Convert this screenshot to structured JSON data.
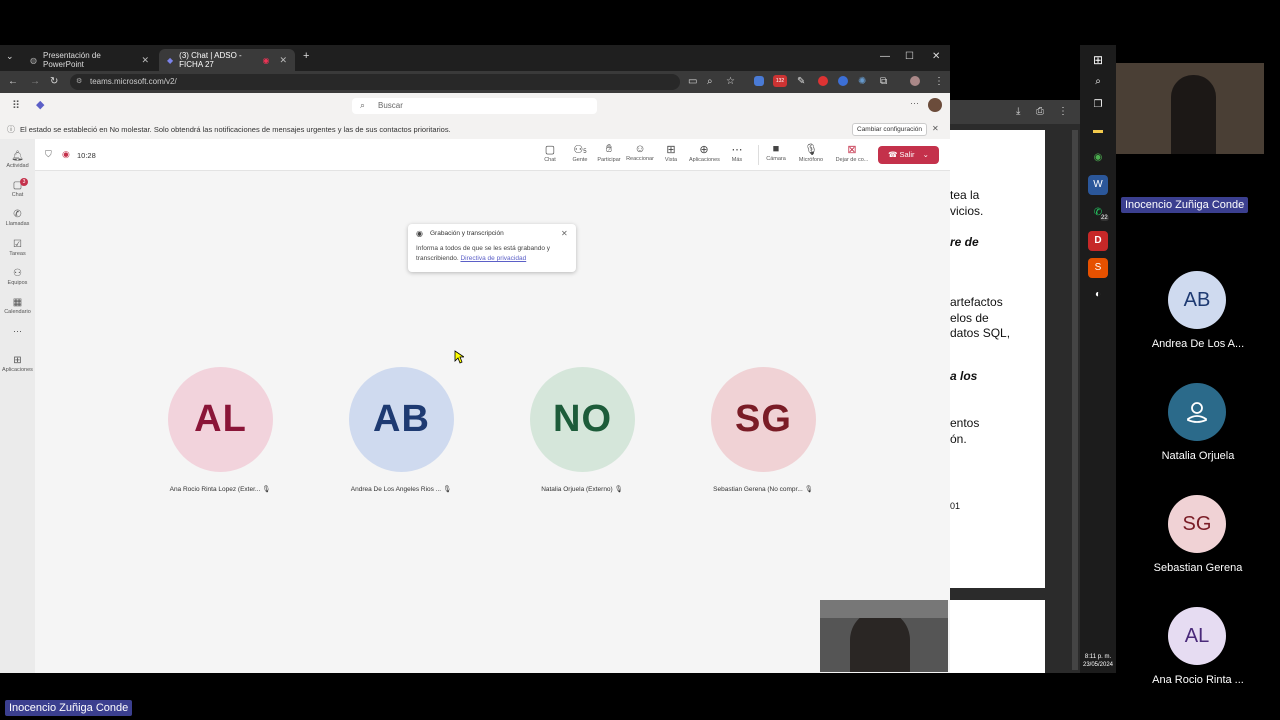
{
  "browser": {
    "tabs": [
      {
        "title": "Presentación de PowerPoint"
      },
      {
        "title": "(3) Chat | ADSO - FICHA 27"
      }
    ],
    "url": "teams.microsoft.com/v2/",
    "badge_count": "132"
  },
  "teams": {
    "search_placeholder": "Buscar",
    "notice": "El estado se estableció en No molestar. Solo obtendrá las notificaciones de mensajes urgentes y las de sus contactos prioritarios.",
    "notice_button": "Cambiar configuración",
    "rail": [
      {
        "label": "Actividad",
        "icon": "bell-icon"
      },
      {
        "label": "Chat",
        "icon": "chat-icon",
        "badge": "3"
      },
      {
        "label": "Llamadas",
        "icon": "phone-icon"
      },
      {
        "label": "Tareas",
        "icon": "tasks-icon"
      },
      {
        "label": "Equipos",
        "icon": "teams-icon"
      },
      {
        "label": "Calendario",
        "icon": "calendar-icon"
      },
      {
        "label": "Aplicaciones",
        "icon": "apps-icon"
      }
    ],
    "meeting": {
      "timer": "10:28",
      "toolbar": [
        {
          "label": "Chat",
          "icon": "chat-icon"
        },
        {
          "label": "Gente",
          "icon": "people-icon",
          "count": "5"
        },
        {
          "label": "Participar",
          "icon": "hand-icon"
        },
        {
          "label": "Reaccionar",
          "icon": "smile-icon"
        },
        {
          "label": "Vista",
          "icon": "grid-icon"
        },
        {
          "label": "Aplicaciones",
          "icon": "plus-icon"
        },
        {
          "label": "Más",
          "icon": "more-icon"
        },
        {
          "label": "Cámara",
          "icon": "camera-icon"
        },
        {
          "label": "Micrófono",
          "icon": "mic-icon"
        },
        {
          "label": "Dejar de co...",
          "icon": "stop-share-icon"
        }
      ],
      "leave_label": "Salir",
      "recording": {
        "title": "Grabación y transcripción",
        "body": "Informa a todos de que se les está grabando y transcribiendo.",
        "link": "Directiva de privacidad"
      },
      "participants": [
        {
          "initials": "AL",
          "name": "Ana Rocio Rinta Lopez (Exter...",
          "bg": "#f2d3dc",
          "fg": "#8a1538"
        },
        {
          "initials": "AB",
          "name": "Andrea De Los Angeles Rios ...",
          "bg": "#cfdaef",
          "fg": "#1e3a72"
        },
        {
          "initials": "NO",
          "name": "Natalia Orjuela (Externo)",
          "bg": "#d5e6da",
          "fg": "#1d5c3a"
        },
        {
          "initials": "SG",
          "name": "Sebastian Gerena (No compr...",
          "bg": "#f0d2d5",
          "fg": "#7a1c26"
        }
      ]
    }
  },
  "bg_document": {
    "lines": [
      "tea la",
      "vicios.",
      "re de",
      "artefactos",
      "elos de",
      "datos SQL,",
      "a los",
      "entos",
      "ón.",
      "01"
    ]
  },
  "taskbar": {
    "time": "8:11 p. m.",
    "date": "23/05/2024",
    "whatsapp_badge": "22"
  },
  "right_panel": {
    "speaker_name": "Inocencio Zuñiga Conde",
    "participants": [
      {
        "initials": "AB",
        "name": "Andrea De Los A...",
        "bg": "#cfdaef",
        "fg": "#1e3a72"
      },
      {
        "initials": "",
        "name": "Natalia Orjuela",
        "bg": "#2b6a8a",
        "fg": "#ffffff"
      },
      {
        "initials": "SG",
        "name": "Sebastian Gerena",
        "bg": "#f0d2d5",
        "fg": "#7a1c26"
      },
      {
        "initials": "AL",
        "name": "Ana Rocio Rinta ...",
        "bg": "#e6dcf2",
        "fg": "#4a2a7a"
      }
    ]
  },
  "bottom_name": "Inocencio Zuñiga Conde"
}
